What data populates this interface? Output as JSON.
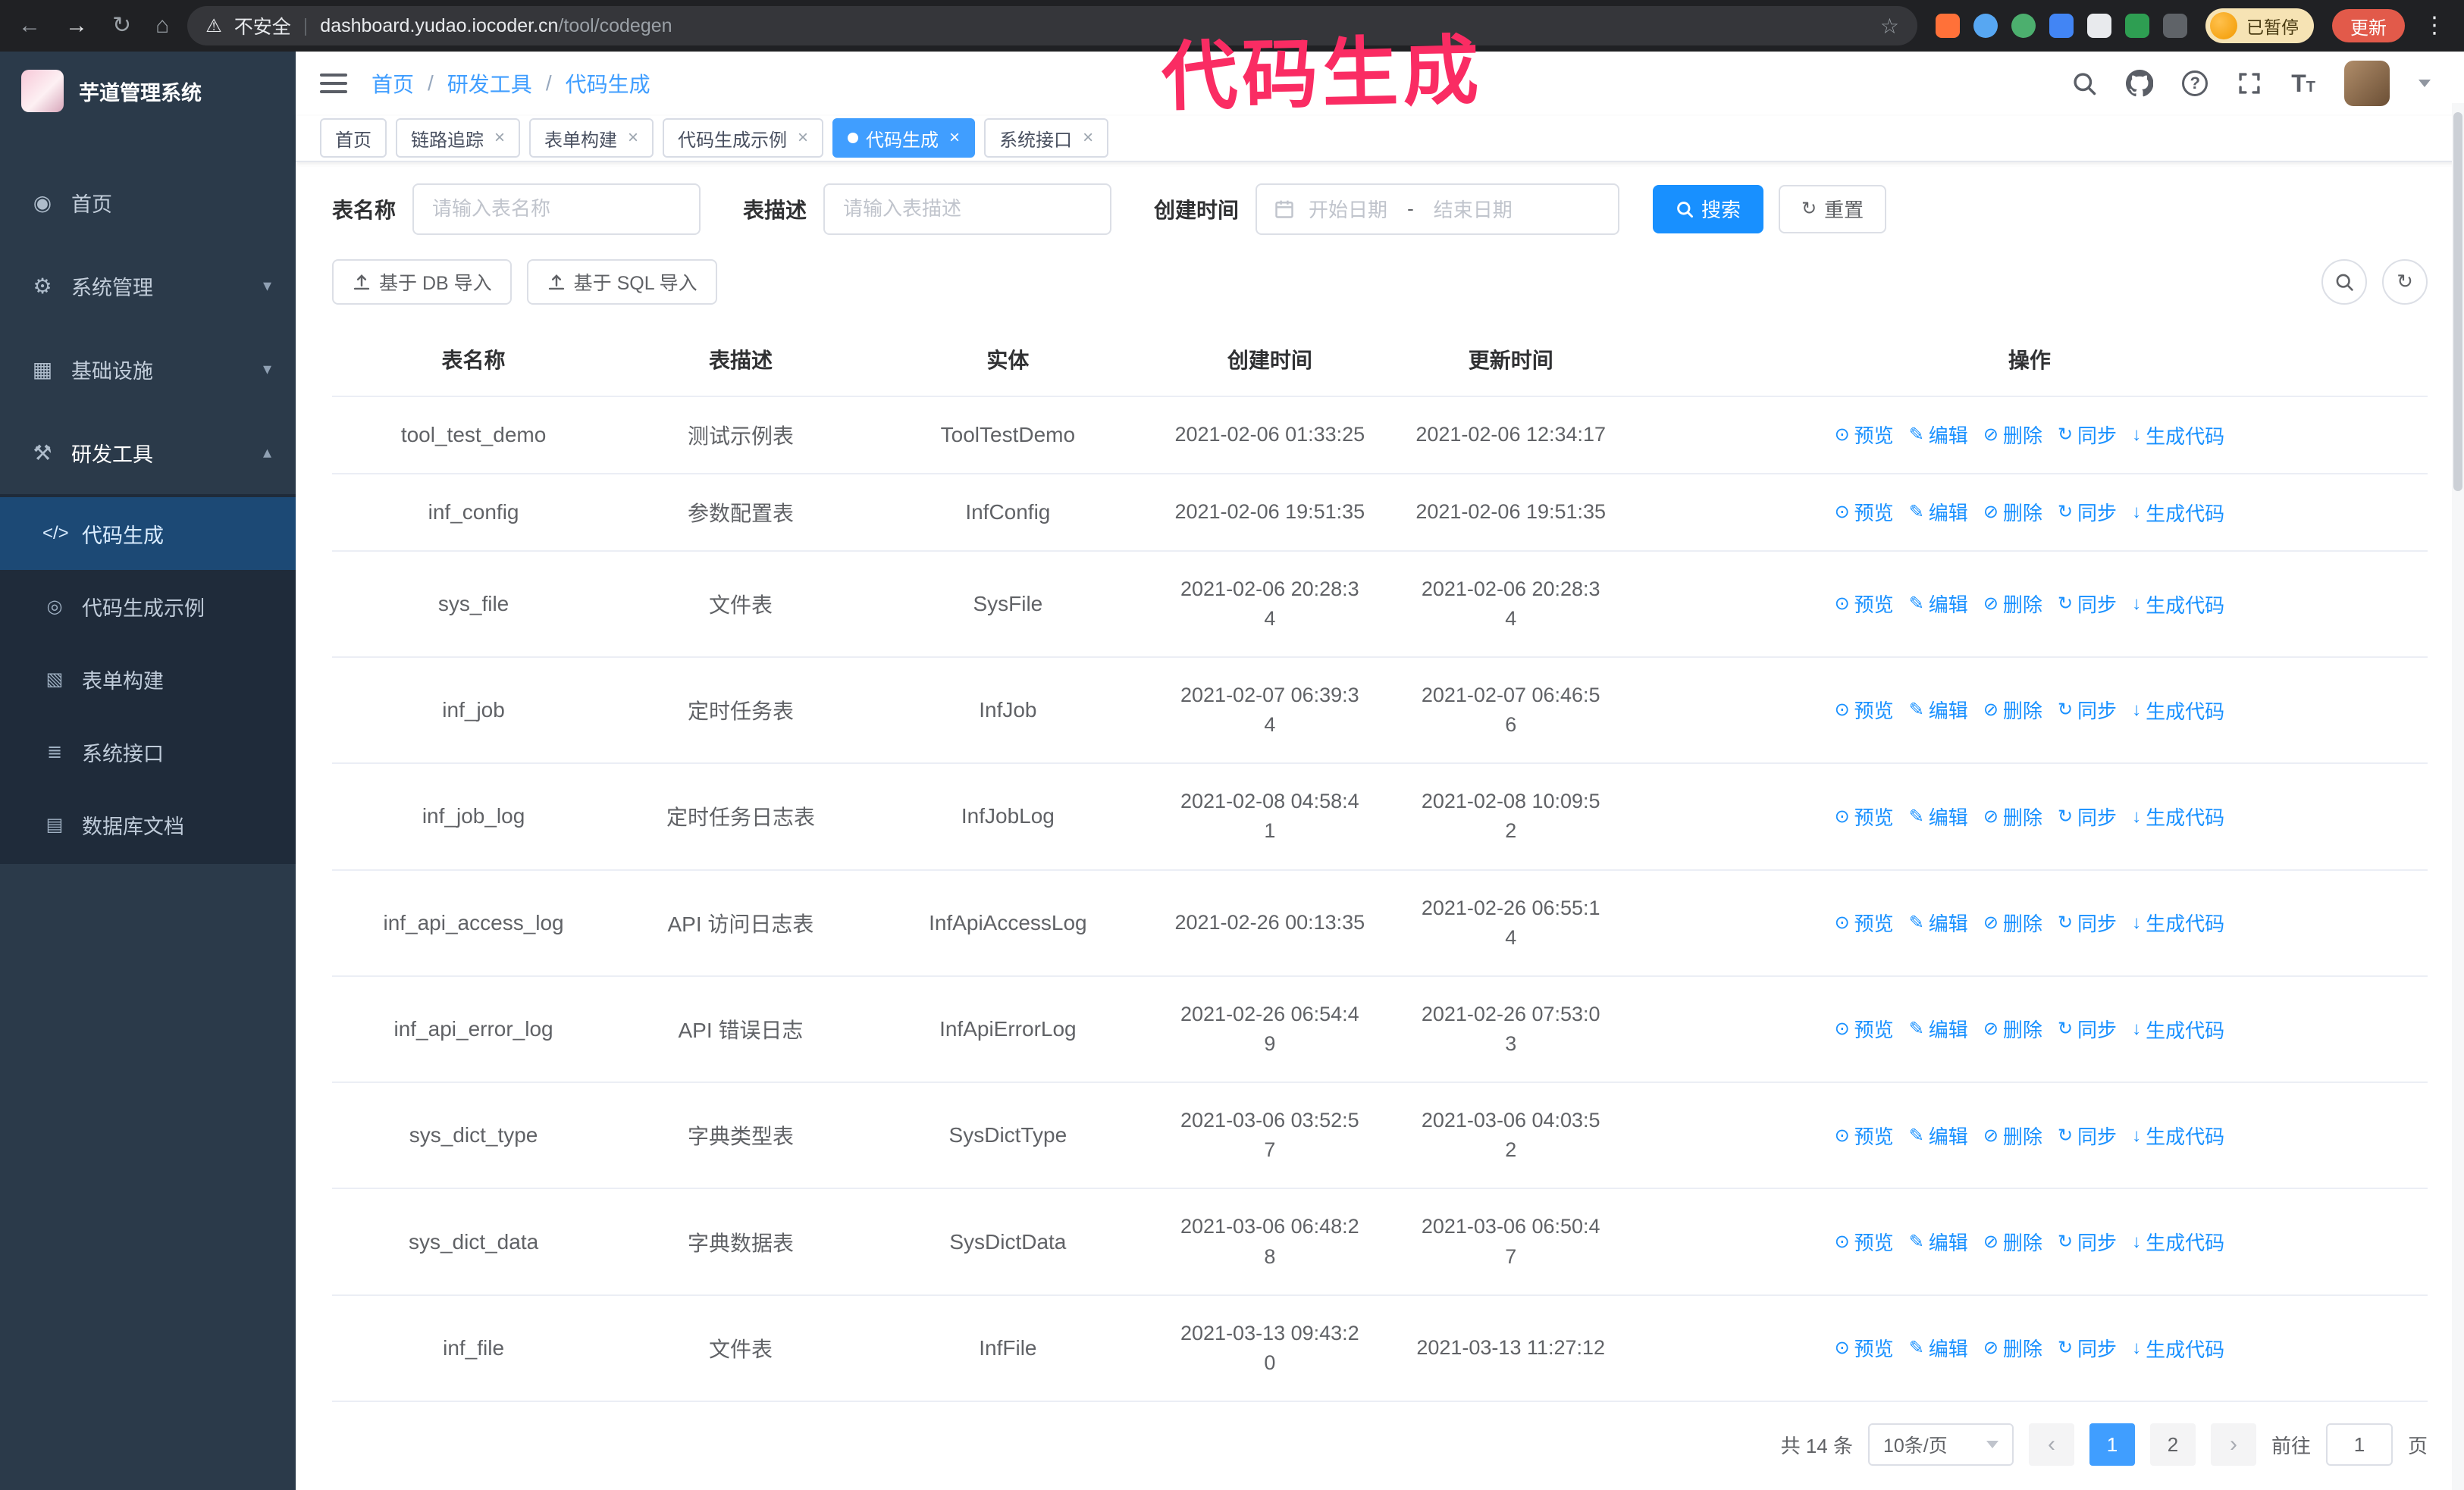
{
  "annotation": {
    "text": "代码生成",
    "color": "#fa2c63"
  },
  "icons": {
    "back": "←",
    "forward": "→",
    "reload": "↻",
    "home": "⌂",
    "warning": "⚠",
    "star": "☆",
    "more": "⋮",
    "question": "?",
    "font_size": "T",
    "caret_down": "▾",
    "caret_up": "▴",
    "close": "×",
    "prev": "‹",
    "next": "›",
    "refresh": "↻"
  },
  "browser": {
    "security_label": "不安全",
    "divider": "|",
    "url_host": "dashboard.yudao.iocoder.cn",
    "url_path": "/tool/codegen",
    "paused_badge": "已暂停",
    "update_button": "更新"
  },
  "sidebar": {
    "logo_title": "芋道管理系统",
    "items": [
      {
        "label": "首页",
        "icon": "◉"
      },
      {
        "label": "系统管理",
        "icon": "⚙"
      },
      {
        "label": "基础设施",
        "icon": "▦"
      },
      {
        "label": "研发工具",
        "icon": "⚒"
      }
    ],
    "submenu": [
      {
        "label": "代码生成",
        "icon": "</>"
      },
      {
        "label": "代码生成示例",
        "icon": "◎"
      },
      {
        "label": "表单构建",
        "icon": "▧"
      },
      {
        "label": "系统接口",
        "icon": "≣"
      },
      {
        "label": "数据库文档",
        "icon": "▤"
      }
    ]
  },
  "header": {
    "breadcrumb": [
      "首页",
      "研发工具",
      "代码生成"
    ],
    "breadcrumb_separator": "/"
  },
  "tabs": [
    {
      "label": "首页"
    },
    {
      "label": "链路追踪"
    },
    {
      "label": "表单构建"
    },
    {
      "label": "代码生成示例"
    },
    {
      "label": "代码生成"
    },
    {
      "label": "系统接口"
    }
  ],
  "filters": {
    "table_name_label": "表名称",
    "table_name_placeholder": "请输入表名称",
    "table_desc_label": "表描述",
    "table_desc_placeholder": "请输入表描述",
    "create_time_label": "创建时间",
    "date_start_placeholder": "开始日期",
    "date_separator": "-",
    "date_end_placeholder": "结束日期",
    "search_button": "搜索",
    "reset_button": "重置"
  },
  "toolbar": {
    "import_db": "基于 DB 导入",
    "import_sql": "基于 SQL 导入"
  },
  "table": {
    "columns": [
      "表名称",
      "表描述",
      "实体",
      "创建时间",
      "更新时间",
      "操作"
    ],
    "actions": [
      "预览",
      "编辑",
      "删除",
      "同步",
      "生成代码"
    ],
    "action_icons": [
      "⊙",
      "✎",
      "⊘",
      "↻",
      "↓"
    ],
    "rows": [
      {
        "name": "tool_test_demo",
        "desc": "测试示例表",
        "entity": "ToolTestDemo",
        "create_time": "2021-02-06 01:33:25",
        "update_time": "2021-02-06 12:34:17"
      },
      {
        "name": "inf_config",
        "desc": "参数配置表",
        "entity": "InfConfig",
        "create_time": "2021-02-06 19:51:35",
        "update_time": "2021-02-06 19:51:35"
      },
      {
        "name": "sys_file",
        "desc": "文件表",
        "entity": "SysFile",
        "create_time": "2021-02-06 20:28:3\n4",
        "update_time": "2021-02-06 20:28:3\n4"
      },
      {
        "name": "inf_job",
        "desc": "定时任务表",
        "entity": "InfJob",
        "create_time": "2021-02-07 06:39:3\n4",
        "update_time": "2021-02-07 06:46:5\n6"
      },
      {
        "name": "inf_job_log",
        "desc": "定时任务日志表",
        "entity": "InfJobLog",
        "create_time": "2021-02-08 04:58:4\n1",
        "update_time": "2021-02-08 10:09:5\n2"
      },
      {
        "name": "inf_api_access_log",
        "desc": "API 访问日志表",
        "entity": "InfApiAccessLog",
        "create_time": "2021-02-26 00:13:35",
        "update_time": "2021-02-26 06:55:1\n4"
      },
      {
        "name": "inf_api_error_log",
        "desc": "API 错误日志",
        "entity": "InfApiErrorLog",
        "create_time": "2021-02-26 06:54:4\n9",
        "update_time": "2021-02-26 07:53:0\n3"
      },
      {
        "name": "sys_dict_type",
        "desc": "字典类型表",
        "entity": "SysDictType",
        "create_time": "2021-03-06 03:52:5\n7",
        "update_time": "2021-03-06 04:03:5\n2"
      },
      {
        "name": "sys_dict_data",
        "desc": "字典数据表",
        "entity": "SysDictData",
        "create_time": "2021-03-06 06:48:2\n8",
        "update_time": "2021-03-06 06:50:4\n7"
      },
      {
        "name": "inf_file",
        "desc": "文件表",
        "entity": "InfFile",
        "create_time": "2021-03-13 09:43:2\n0",
        "update_time": "2021-03-13 11:27:12"
      }
    ]
  },
  "pagination": {
    "total": "共 14 条",
    "page_size": "10条/页",
    "pages": [
      "1",
      "2"
    ],
    "goto_label": "前往",
    "goto_value": "1",
    "goto_suffix": "页"
  }
}
